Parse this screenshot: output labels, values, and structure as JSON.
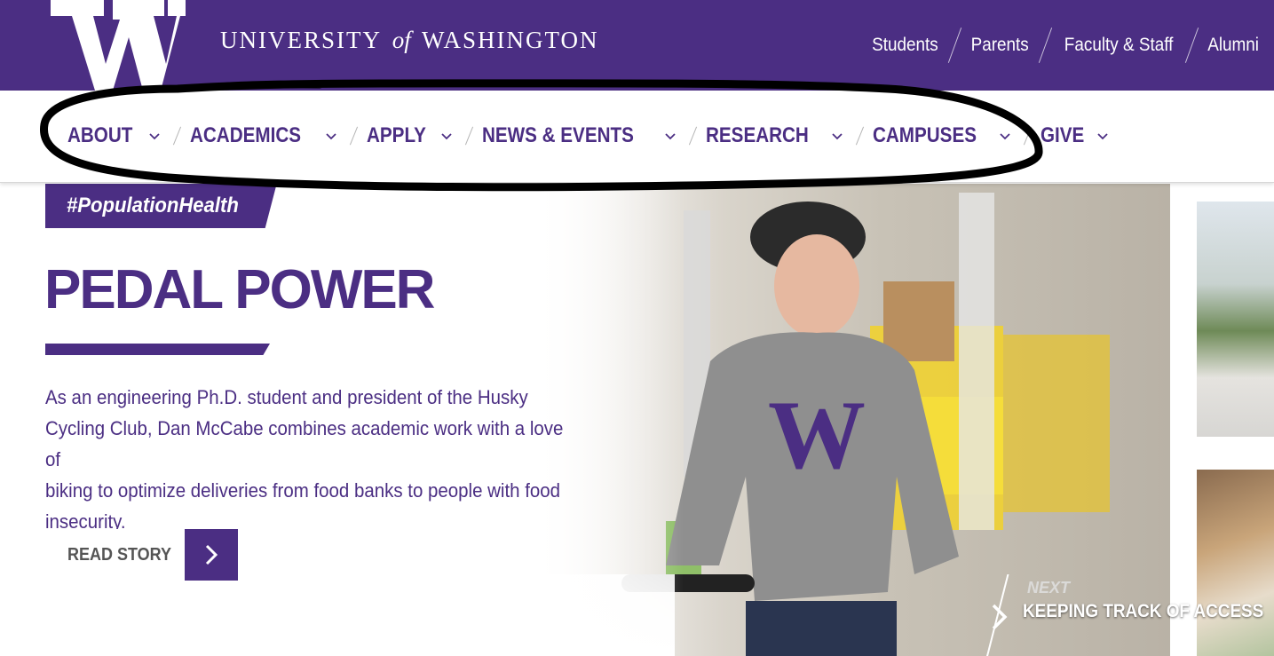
{
  "brand": {
    "logo_letter": "W",
    "wordmark_pre": "UNIVERSITY",
    "wordmark_of": "of",
    "wordmark_post": "WASHINGTON",
    "purple": "#4b2e83",
    "gold": "#b7a57a"
  },
  "audience_links": [
    {
      "label": "Students"
    },
    {
      "label": "Parents"
    },
    {
      "label": "Faculty & Staff"
    },
    {
      "label": "Alumni"
    }
  ],
  "main_nav": [
    {
      "label": "ABOUT",
      "icon": "chevron-down-icon"
    },
    {
      "label": "ACADEMICS",
      "icon": "chevron-down-icon"
    },
    {
      "label": "APPLY",
      "icon": "chevron-down-icon"
    },
    {
      "label": "NEWS & EVENTS",
      "icon": "chevron-down-icon"
    },
    {
      "label": "RESEARCH",
      "icon": "chevron-down-icon"
    },
    {
      "label": "CAMPUSES",
      "icon": "chevron-down-icon"
    },
    {
      "label": "GIVE",
      "icon": "chevron-down-icon"
    }
  ],
  "hero": {
    "tag": "#PopulationHealth",
    "headline": "PEDAL POWER",
    "blurb_lines": [
      "As an engineering Ph.D. student and president of the Husky",
      "Cycling Club, Dan McCabe combines academic work with a love of",
      "biking to optimize deliveries from food banks to people with food",
      "insecurity."
    ],
    "cta_label": "READ STORY",
    "cta_icon": "chevron-right-icon",
    "shirt_letter": "W"
  },
  "next_story": {
    "label": "NEXT",
    "title": "KEEPING TRACK OF ACCESS",
    "icon": "chevron-right-icon"
  },
  "annotation": {
    "color": "#000000"
  }
}
